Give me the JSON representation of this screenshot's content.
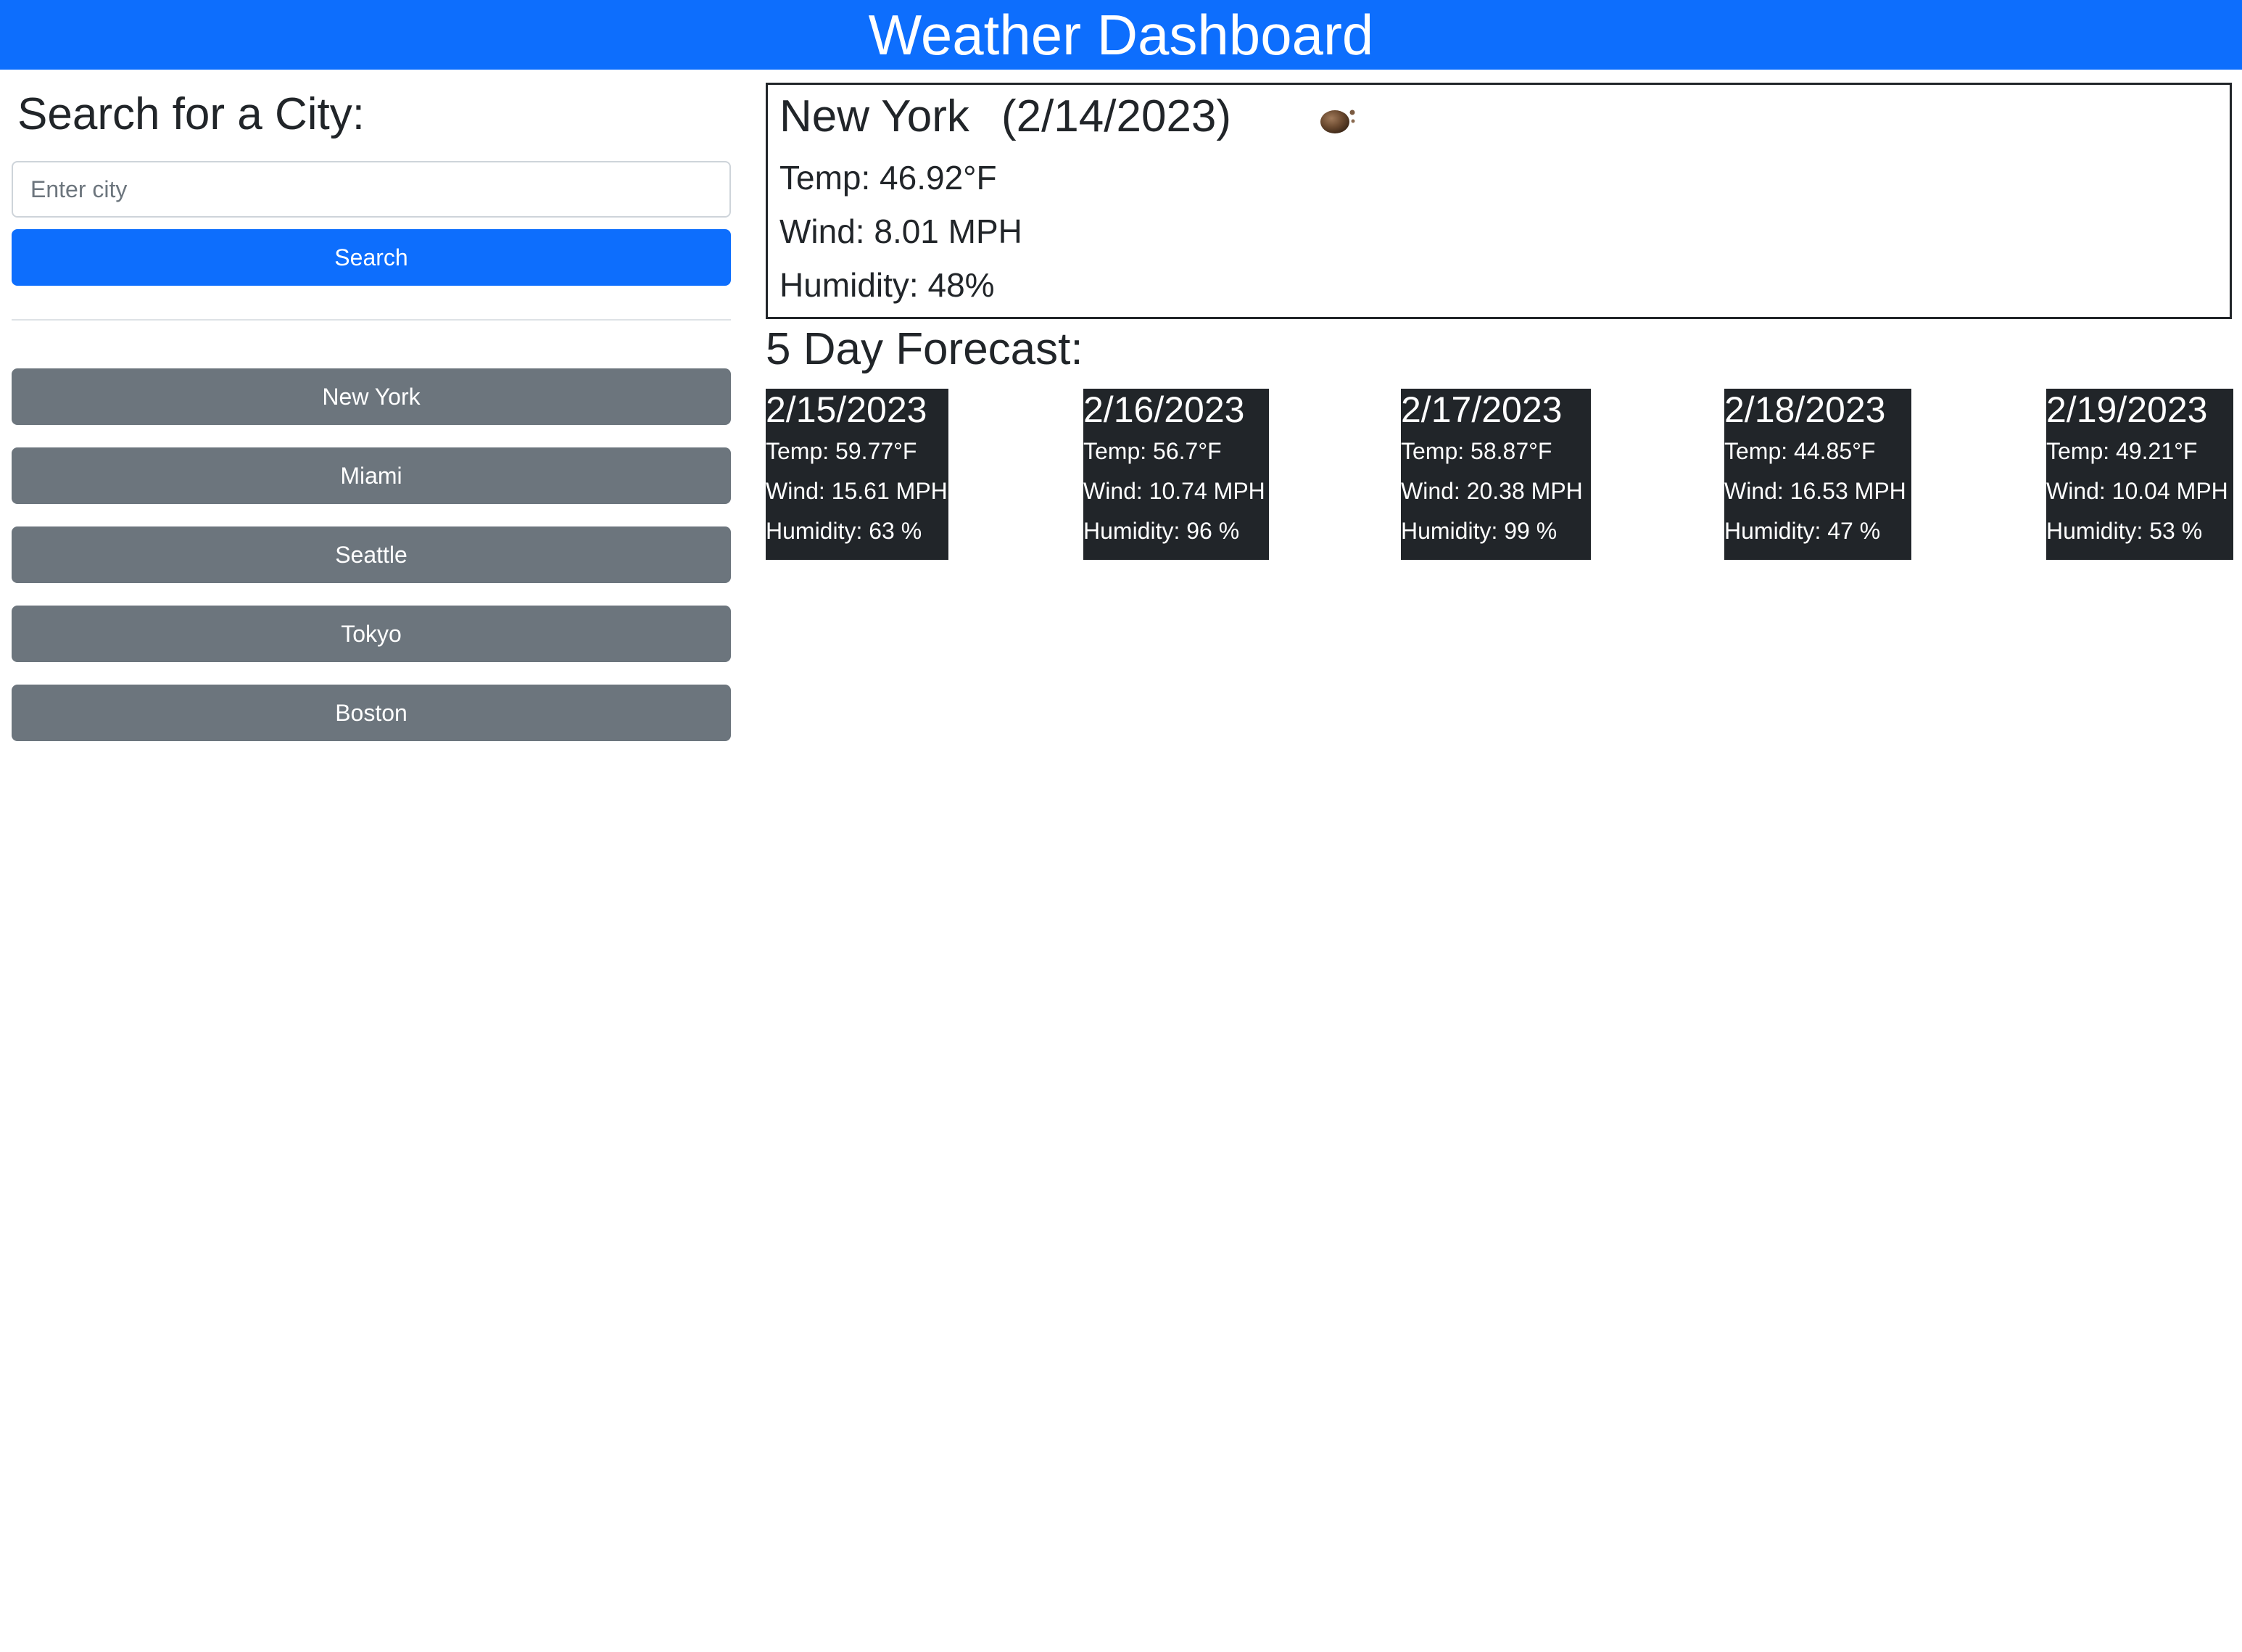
{
  "header": {
    "title": "Weather Dashboard"
  },
  "search": {
    "title": "Search for a City:",
    "placeholder": "Enter city",
    "value": "",
    "button_label": "Search"
  },
  "history": [
    {
      "label": "New York"
    },
    {
      "label": "Miami"
    },
    {
      "label": "Seattle"
    },
    {
      "label": "Tokyo"
    },
    {
      "label": "Boston"
    }
  ],
  "current": {
    "city": "New York",
    "date": "(2/14/2023)",
    "icon": "clouds-icon",
    "temp": "Temp: 46.92°F",
    "wind": "Wind: 8.01 MPH",
    "humidity": "Humidity: 48%"
  },
  "forecast": {
    "title": "5 Day Forecast:",
    "days": [
      {
        "date": "2/15/2023",
        "temp": "Temp: 59.77°F",
        "wind": "Wind: 15.61 MPH",
        "humidity": "Humidity: 63 %"
      },
      {
        "date": "2/16/2023",
        "temp": "Temp: 56.7°F",
        "wind": "Wind: 10.74 MPH",
        "humidity": "Humidity: 96 %"
      },
      {
        "date": "2/17/2023",
        "temp": "Temp: 58.87°F",
        "wind": "Wind: 20.38 MPH",
        "humidity": "Humidity: 99 %"
      },
      {
        "date": "2/18/2023",
        "temp": "Temp: 44.85°F",
        "wind": "Wind: 16.53 MPH",
        "humidity": "Humidity: 47 %"
      },
      {
        "date": "2/19/2023",
        "temp": "Temp: 49.21°F",
        "wind": "Wind: 10.04 MPH",
        "humidity": "Humidity: 53 %"
      }
    ]
  },
  "colors": {
    "primary": "#0d6efd",
    "secondary": "#6c757d",
    "dark": "#212529",
    "border": "#ced4da"
  }
}
